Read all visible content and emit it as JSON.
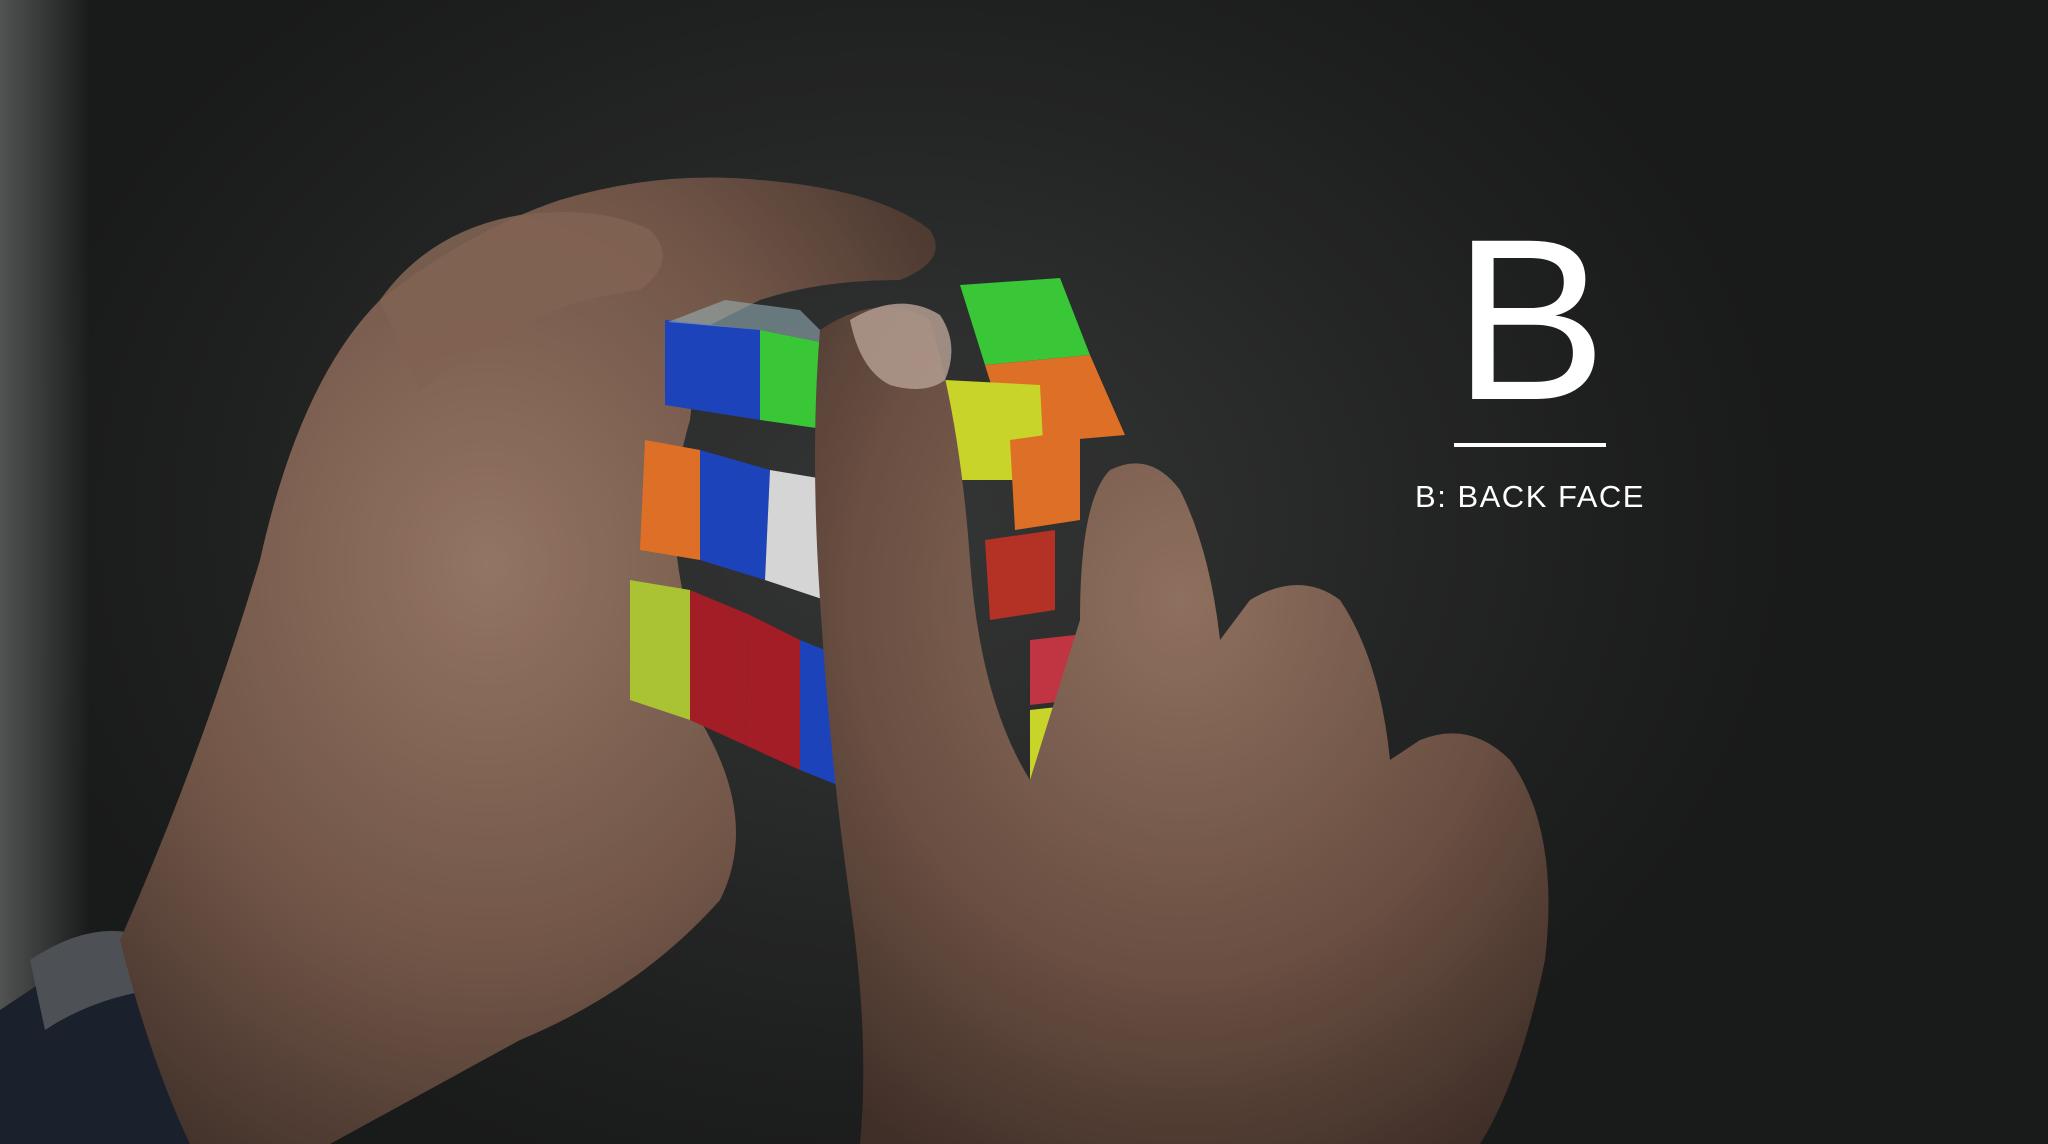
{
  "overlay": {
    "letter": "B",
    "caption": "B: BACK FACE"
  },
  "colors": {
    "background": "#252626",
    "text": "#ffffff",
    "cube_blue": "#1f49c9",
    "cube_green": "#3ed73c",
    "cube_orange": "#f07a2a",
    "cube_red": "#b0202a",
    "cube_white": "#e8e8e8",
    "cube_yellow": "#d9e62e",
    "skin": "#8a6a58"
  }
}
